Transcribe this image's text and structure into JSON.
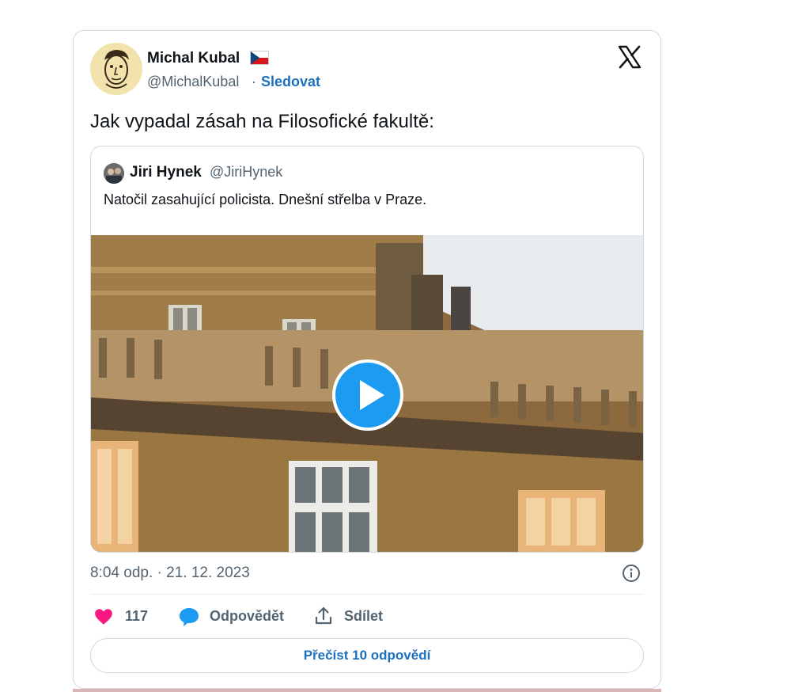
{
  "author": {
    "name": "Michal Kubal",
    "handle": "@MichalKubal",
    "separator": "·",
    "follow_label": "Sledovat"
  },
  "tweet": {
    "text": "Jak vypadal zásah na Filosofické fakultě:",
    "timestamp": "8:04 odp. · 21. 12. 2023"
  },
  "quoted": {
    "name": "Jiri Hynek",
    "handle": "@JiriHynek",
    "text": "Natočil zasahující policista. Dnešní střelba v Praze."
  },
  "actions": {
    "likes": "117",
    "reply_label": "Odpovědět",
    "share_label": "Sdílet",
    "read_replies_label": "Přečíst 10 odpovědí"
  },
  "colors": {
    "accent": "#1d9bf0",
    "link": "#1d6fbf",
    "heart": "#f91880",
    "muted": "#536471"
  },
  "icons": [
    "czech-flag-icon",
    "x-logo-icon",
    "play-icon",
    "info-icon",
    "heart-icon",
    "reply-bubble-icon",
    "share-icon"
  ]
}
